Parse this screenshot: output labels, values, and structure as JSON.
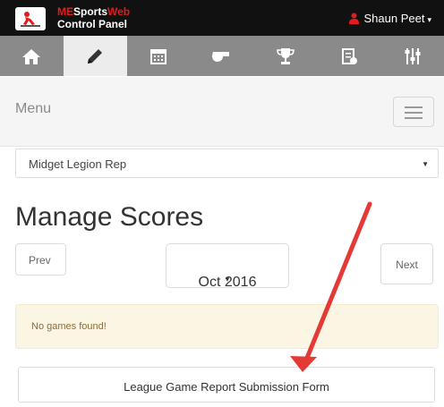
{
  "header": {
    "brand_part1": "ME",
    "brand_part2": "Sports",
    "brand_part3": "Web",
    "brand_line2": "Control Panel",
    "user_name": "Shaun Peet",
    "user_caret": "▾"
  },
  "nav": {
    "items": [
      {
        "icon": "home-icon",
        "active": false
      },
      {
        "icon": "pencil-icon",
        "active": true
      },
      {
        "icon": "calendar-icon",
        "active": false
      },
      {
        "icon": "whistle-icon",
        "active": false
      },
      {
        "icon": "trophy-icon",
        "active": false
      },
      {
        "icon": "clipboard-icon",
        "active": false
      },
      {
        "icon": "sliders-icon",
        "active": false
      }
    ]
  },
  "menu": {
    "label": "Menu"
  },
  "team_select": {
    "selected": "Midget Legion Rep",
    "caret": "▼"
  },
  "page": {
    "title": "Manage Scores",
    "prev_label": "Prev",
    "month_label": "Oct 2016",
    "month_caret": "▾",
    "next_label": "Next",
    "alert_text": "No games found!",
    "submit_label": "League Game Report Submission Form"
  },
  "colors": {
    "accent_red": "#e31b1b",
    "annotation_arrow": "#e53935",
    "topbar": "#111111",
    "iconbar": "#8a8a8a",
    "alert_bg": "#fbf6e4",
    "alert_text": "#8a6d3b"
  }
}
